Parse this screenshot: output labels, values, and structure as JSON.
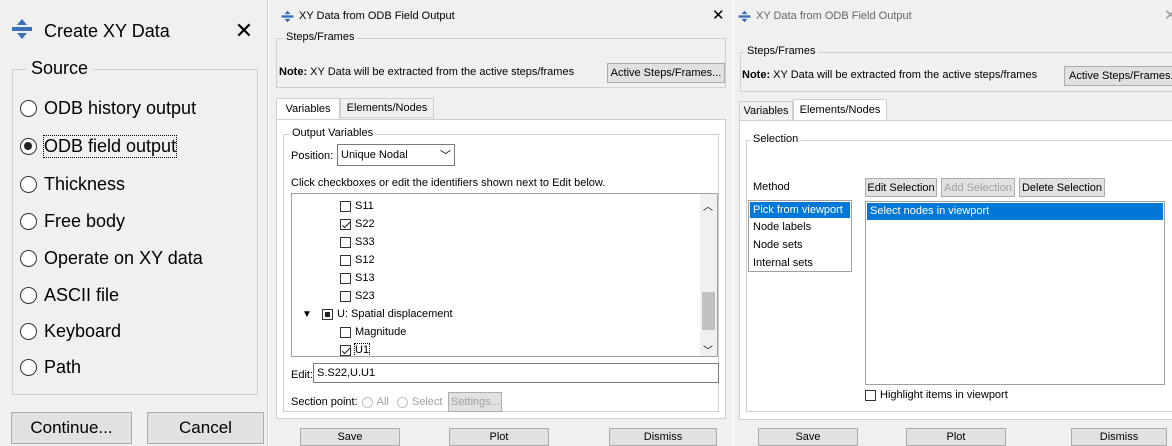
{
  "create_xy": {
    "title": "Create XY Data",
    "close": "✕",
    "source_label": "Source",
    "options": [
      {
        "label": "ODB history output",
        "selected": false
      },
      {
        "label": "ODB field output",
        "selected": true
      },
      {
        "label": "Thickness",
        "selected": false
      },
      {
        "label": "Free body",
        "selected": false
      },
      {
        "label": "Operate on XY data",
        "selected": false
      },
      {
        "label": "ASCII file",
        "selected": false
      },
      {
        "label": "Keyboard",
        "selected": false
      },
      {
        "label": "Path",
        "selected": false
      }
    ],
    "continue_label": "Continue...",
    "cancel_label": "Cancel"
  },
  "field_dlg_1": {
    "title": "XY Data from ODB Field Output",
    "close": "✕",
    "steps_frames_label": "Steps/Frames",
    "note_label": "Note:",
    "note_text": "XY Data will be extracted from the active steps/frames",
    "active_steps_btn": "Active Steps/Frames...",
    "tabs": [
      "Variables",
      "Elements/Nodes"
    ],
    "output_variables_label": "Output Variables",
    "position_label": "Position:",
    "position_value": "Unique Nodal",
    "instructions": "Click checkboxes or edit the identifiers shown next to Edit below.",
    "variables": [
      {
        "label": "S11",
        "checked": false
      },
      {
        "label": "S22",
        "checked": true
      },
      {
        "label": "S33",
        "checked": false
      },
      {
        "label": "S12",
        "checked": false
      },
      {
        "label": "S13",
        "checked": false
      },
      {
        "label": "S23",
        "checked": false
      }
    ],
    "group_label": "U: Spatial displacement",
    "group_children": [
      {
        "label": "Magnitude",
        "checked": false
      },
      {
        "label": "U1",
        "checked": true
      }
    ],
    "edit_label": "Edit:",
    "edit_value": "S.S22,U.U1",
    "section_point_label": "Section point:",
    "all_label": "All",
    "select_label": "Select",
    "settings_btn": "Settings...",
    "save_btn": "Save",
    "plot_btn": "Plot",
    "dismiss_btn": "Dismiss"
  },
  "field_dlg_2": {
    "title": "XY Data from ODB Field Output",
    "close": "✕",
    "steps_frames_label": "Steps/Frames",
    "note_label": "Note:",
    "note_text": "XY Data will be extracted from the active steps/frames",
    "active_steps_btn": "Active Steps/Frames...",
    "tabs": [
      "Variables",
      "Elements/Nodes"
    ],
    "selection_label": "Selection",
    "method_label": "Method",
    "edit_selection_btn": "Edit Selection",
    "add_selection_btn": "Add Selection",
    "delete_selection_btn": "Delete Selection",
    "methods": [
      "Pick from viewport",
      "Node labels",
      "Node sets",
      "Internal sets"
    ],
    "selected_method_text": "Select nodes in viewport",
    "highlight_label": "Highlight items in viewport",
    "save_btn": "Save",
    "plot_btn": "Plot",
    "dismiss_btn": "Dismiss"
  },
  "colors": {
    "selection_blue": "#0078d7",
    "dialog_bg": "#f0f0f0",
    "abaqus_icon": "#3a6fb8"
  }
}
